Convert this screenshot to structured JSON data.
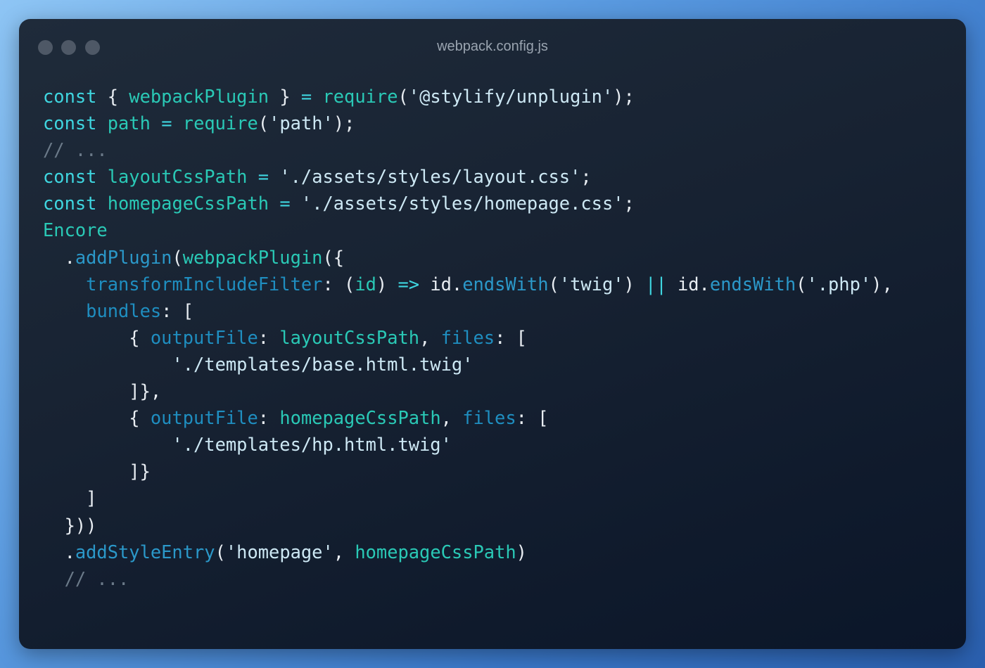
{
  "window": {
    "title": "webpack.config.js"
  },
  "colors": {
    "keyword": "#3fd6e0",
    "identifier": "#2ac9b6",
    "function": "#2b98c9",
    "property": "#1f8ec0",
    "string": "#cde8f4",
    "comment": "#6b7a89",
    "plain": "#e8edf2"
  },
  "code_lines": [
    [
      [
        "kw",
        "const"
      ],
      [
        "pl",
        " { "
      ],
      [
        "tl",
        "webpackPlugin"
      ],
      [
        "pl",
        " } "
      ],
      [
        "op",
        "="
      ],
      [
        "pl",
        " "
      ],
      [
        "tl",
        "require"
      ],
      [
        "pl",
        "("
      ],
      [
        "st",
        "'@stylify/unplugin'"
      ],
      [
        "pl",
        ");"
      ]
    ],
    [
      [
        "kw",
        "const"
      ],
      [
        "pl",
        " "
      ],
      [
        "tl",
        "path"
      ],
      [
        "pl",
        " "
      ],
      [
        "op",
        "="
      ],
      [
        "pl",
        " "
      ],
      [
        "tl",
        "require"
      ],
      [
        "pl",
        "("
      ],
      [
        "st",
        "'path'"
      ],
      [
        "pl",
        ");"
      ]
    ],
    [
      [
        "cm",
        "// ..."
      ]
    ],
    [
      [
        "kw",
        "const"
      ],
      [
        "pl",
        " "
      ],
      [
        "tl",
        "layoutCssPath"
      ],
      [
        "pl",
        " "
      ],
      [
        "op",
        "="
      ],
      [
        "pl",
        " "
      ],
      [
        "st",
        "'./assets/styles/layout.css'"
      ],
      [
        "pl",
        ";"
      ]
    ],
    [
      [
        "kw",
        "const"
      ],
      [
        "pl",
        " "
      ],
      [
        "tl",
        "homepageCssPath"
      ],
      [
        "pl",
        " "
      ],
      [
        "op",
        "="
      ],
      [
        "pl",
        " "
      ],
      [
        "st",
        "'./assets/styles/homepage.css'"
      ],
      [
        "pl",
        ";"
      ]
    ],
    [
      [
        "tl",
        "Encore"
      ]
    ],
    [
      [
        "pl",
        "  ."
      ],
      [
        "fn",
        "addPlugin"
      ],
      [
        "pl",
        "("
      ],
      [
        "tl",
        "webpackPlugin"
      ],
      [
        "pl",
        "({"
      ]
    ],
    [
      [
        "pl",
        "    "
      ],
      [
        "pr",
        "transformIncludeFilter"
      ],
      [
        "pl",
        ": ("
      ],
      [
        "tl",
        "id"
      ],
      [
        "pl",
        ") "
      ],
      [
        "op",
        "=>"
      ],
      [
        "pl",
        " id."
      ],
      [
        "fn",
        "endsWith"
      ],
      [
        "pl",
        "("
      ],
      [
        "st",
        "'twig'"
      ],
      [
        "pl",
        ") "
      ],
      [
        "op",
        "||"
      ],
      [
        "pl",
        " id."
      ],
      [
        "fn",
        "endsWith"
      ],
      [
        "pl",
        "("
      ],
      [
        "st",
        "'.php'"
      ],
      [
        "pl",
        "),"
      ]
    ],
    [
      [
        "pl",
        "    "
      ],
      [
        "pr",
        "bundles"
      ],
      [
        "pl",
        ": ["
      ]
    ],
    [
      [
        "pl",
        "        { "
      ],
      [
        "pr",
        "outputFile"
      ],
      [
        "pl",
        ": "
      ],
      [
        "tl",
        "layoutCssPath"
      ],
      [
        "pl",
        ", "
      ],
      [
        "pr",
        "files"
      ],
      [
        "pl",
        ": ["
      ]
    ],
    [
      [
        "pl",
        "            "
      ],
      [
        "st",
        "'./templates/base.html.twig'"
      ]
    ],
    [
      [
        "pl",
        "        ]},"
      ]
    ],
    [
      [
        "pl",
        "        { "
      ],
      [
        "pr",
        "outputFile"
      ],
      [
        "pl",
        ": "
      ],
      [
        "tl",
        "homepageCssPath"
      ],
      [
        "pl",
        ", "
      ],
      [
        "pr",
        "files"
      ],
      [
        "pl",
        ": ["
      ]
    ],
    [
      [
        "pl",
        "            "
      ],
      [
        "st",
        "'./templates/hp.html.twig'"
      ]
    ],
    [
      [
        "pl",
        "        ]}"
      ]
    ],
    [
      [
        "pl",
        "    ]"
      ]
    ],
    [
      [
        "pl",
        "  }))"
      ]
    ],
    [
      [
        "pl",
        "  ."
      ],
      [
        "fn",
        "addStyleEntry"
      ],
      [
        "pl",
        "("
      ],
      [
        "st",
        "'homepage'"
      ],
      [
        "pl",
        ", "
      ],
      [
        "tl",
        "homepageCssPath"
      ],
      [
        "pl",
        ")"
      ]
    ],
    [
      [
        "cm",
        "  // ..."
      ]
    ]
  ]
}
